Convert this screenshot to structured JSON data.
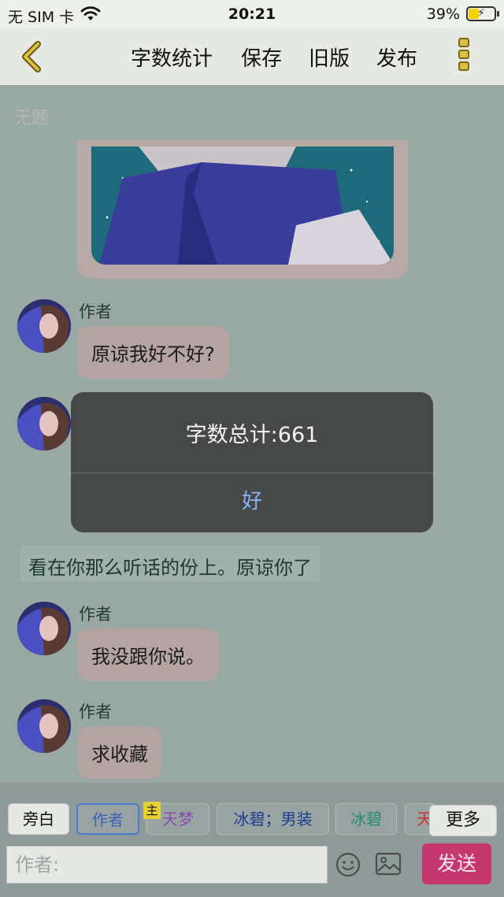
{
  "status_bar": {
    "carrier": "无 SIM 卡",
    "time": "20:21",
    "battery": "39%",
    "battery_level": 0.39
  },
  "nav": {
    "word_count": "字数统计",
    "save": "保存",
    "old_version": "旧版",
    "publish": "发布"
  },
  "page": {
    "title_placeholder": "无题"
  },
  "messages": [
    {
      "author": "作者",
      "text": "原谅我好不好?"
    },
    {
      "author": "",
      "text": ""
    },
    {
      "narration": "看在你那么听话的份上。原谅你了"
    },
    {
      "author": "作者",
      "text": "我没跟你说。"
    },
    {
      "author": "作者",
      "text": "求收藏"
    }
  ],
  "dialog": {
    "message": "字数总计:661",
    "ok": "好"
  },
  "roles": {
    "narration": "旁白",
    "author": "作者",
    "master_badge": "主",
    "tianmeng": "天梦",
    "bibi_male": "冰碧；男装",
    "bibi": "冰碧",
    "partial": "天",
    "more": "更多"
  },
  "composer": {
    "placeholder": "作者:",
    "send": "发送"
  },
  "icons": [
    "wifi-icon",
    "battery-icon",
    "back-chevron-icon",
    "more-menu-icon",
    "emoji-icon",
    "image-icon"
  ]
}
